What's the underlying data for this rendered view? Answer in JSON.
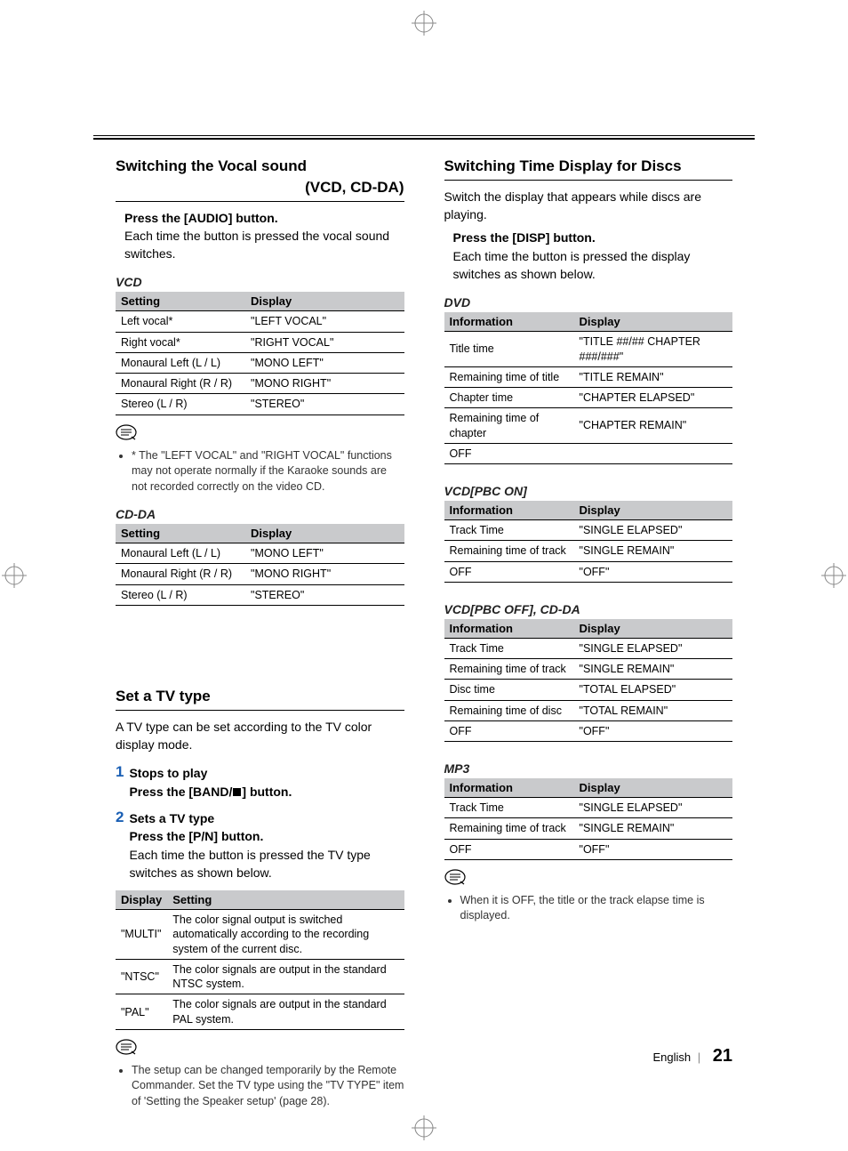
{
  "left": {
    "vocal": {
      "heading_line1": "Switching the Vocal sound",
      "heading_line2": "(VCD, CD-DA)",
      "press": "Press the [AUDIO] button.",
      "desc": "Each time the button is pressed the vocal sound switches.",
      "vcd_label": "VCD",
      "vcd_headers": [
        "Setting",
        "Display"
      ],
      "vcd_rows": [
        [
          "Left vocal*",
          "\"LEFT VOCAL\""
        ],
        [
          "Right vocal*",
          "\"RIGHT VOCAL\""
        ],
        [
          "Monaural Left (L / L)",
          "\"MONO LEFT\""
        ],
        [
          "Monaural Right (R / R)",
          "\"MONO RIGHT\""
        ],
        [
          "Stereo (L / R)",
          "\"STEREO\""
        ]
      ],
      "vcd_note": "* The \"LEFT VOCAL\" and \"RIGHT VOCAL\" functions may not operate normally if the Karaoke sounds are not recorded correctly on the video CD.",
      "cdda_label": "CD-DA",
      "cdda_headers": [
        "Setting",
        "Display"
      ],
      "cdda_rows": [
        [
          "Monaural Left (L / L)",
          "\"MONO LEFT\""
        ],
        [
          "Monaural Right (R / R)",
          "\"MONO RIGHT\""
        ],
        [
          "Stereo (L / R)",
          "\"STEREO\""
        ]
      ]
    },
    "tvtype": {
      "heading": "Set a TV type",
      "intro": "A TV type can be set according to the TV color display mode.",
      "step1_title": "Stops to play",
      "step1_action_pre": "Press the [BAND/",
      "step1_action_post": "] button.",
      "step2_title": "Sets a TV type",
      "step2_action": "Press the [P/N] button.",
      "step2_desc": "Each time the button is pressed the TV type switches as shown below.",
      "headers": [
        "Display",
        "Setting"
      ],
      "rows": [
        [
          "\"MULTI\"",
          "The color signal output is switched automatically according to the recording system of the current disc."
        ],
        [
          "\"NTSC\"",
          "The color signals are output in the standard NTSC system."
        ],
        [
          "\"PAL\"",
          "The color signals are output in the standard PAL system."
        ]
      ],
      "note": "The setup can be changed temporarily by the Remote Commander. Set the TV type using the \"TV TYPE\" item of 'Setting the Speaker setup' (page 28)."
    }
  },
  "right": {
    "time": {
      "heading": "Switching Time Display for Discs",
      "intro": "Switch the display that appears while discs are playing.",
      "press": "Press the [DISP] button.",
      "desc": "Each time the button is pressed the display switches as shown below.",
      "dvd_label": "DVD",
      "info_header": "Information",
      "disp_header": "Display",
      "dvd_rows": [
        [
          "Title time",
          "\"TITLE ##/## CHAPTER ###/###\""
        ],
        [
          "Remaining time of title",
          "\"TITLE REMAIN\""
        ],
        [
          "Chapter time",
          "\"CHAPTER ELAPSED\""
        ],
        [
          "Remaining time of chapter",
          "\"CHAPTER REMAIN\""
        ],
        [
          "OFF",
          ""
        ]
      ],
      "vcd_on_label": "VCD[PBC ON]",
      "vcd_on_rows": [
        [
          "Track Time",
          "\"SINGLE ELAPSED\""
        ],
        [
          "Remaining time of track",
          "\"SINGLE REMAIN\""
        ],
        [
          "OFF",
          "\"OFF\""
        ]
      ],
      "vcd_off_label": "VCD[PBC OFF], CD-DA",
      "vcd_off_rows": [
        [
          "Track Time",
          "\"SINGLE ELAPSED\""
        ],
        [
          "Remaining time of track",
          "\"SINGLE REMAIN\""
        ],
        [
          "Disc time",
          "\"TOTAL ELAPSED\""
        ],
        [
          "Remaining time of disc",
          "\"TOTAL REMAIN\""
        ],
        [
          "OFF",
          "\"OFF\""
        ]
      ],
      "mp3_label": "MP3",
      "mp3_rows": [
        [
          "Track Time",
          "\"SINGLE ELAPSED\""
        ],
        [
          "Remaining time of track",
          "\"SINGLE REMAIN\""
        ],
        [
          "OFF",
          "\"OFF\""
        ]
      ],
      "note": "When it is OFF, the title or the track elapse time is displayed."
    }
  },
  "footer": {
    "lang": "English",
    "page": "21"
  }
}
